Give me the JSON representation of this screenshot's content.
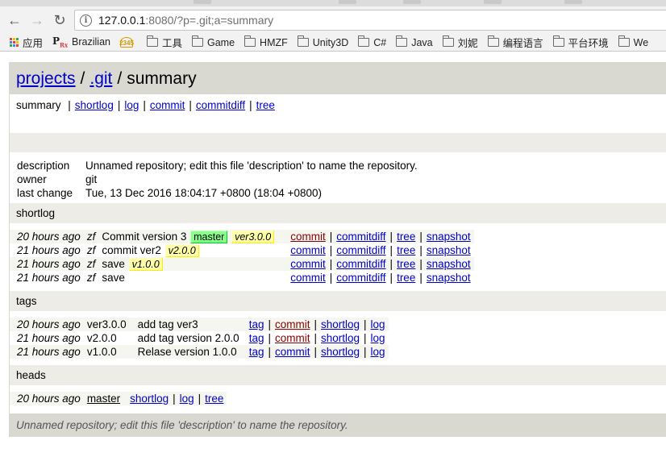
{
  "browser": {
    "url_host": "127.0.0.1",
    "url_rest": ":8080/?p=.git;a=summary",
    "bookmarks": [
      {
        "label": "应用",
        "icon": "apps-grid-icon"
      },
      {
        "label": "Brazilian",
        "icon": "rx-icon"
      },
      {
        "label": "",
        "icon": "2345-icon"
      },
      {
        "label": "工具",
        "icon": "folder-icon"
      },
      {
        "label": "Game",
        "icon": "folder-icon"
      },
      {
        "label": "HMZF",
        "icon": "folder-icon"
      },
      {
        "label": "Unity3D",
        "icon": "folder-icon"
      },
      {
        "label": "C#",
        "icon": "folder-icon"
      },
      {
        "label": "Java",
        "icon": "folder-icon"
      },
      {
        "label": "刘妮",
        "icon": "folder-icon"
      },
      {
        "label": "编程语言",
        "icon": "folder-icon"
      },
      {
        "label": "平台环境",
        "icon": "folder-icon"
      },
      {
        "label": "We",
        "icon": "folder-icon"
      }
    ]
  },
  "header": {
    "projects": "projects",
    "sep": "/",
    "repo": ".git",
    "action": "summary"
  },
  "nav": {
    "current": "summary",
    "links": [
      "shortlog",
      "log",
      "commit",
      "commitdiff",
      "tree"
    ],
    "sep": "|"
  },
  "info": [
    {
      "key": "description",
      "value": "Unnamed repository; edit this file 'description' to name the repository."
    },
    {
      "key": "owner",
      "value": "git"
    },
    {
      "key": "last change",
      "value": "Tue, 13 Dec 2016 18:04:17 +0800 (18:04 +0800)"
    }
  ],
  "shortlog": {
    "title": "shortlog",
    "rows": [
      {
        "age": "20 hours ago",
        "author": "zf",
        "subject": "Commit version 3",
        "heads": [
          "master"
        ],
        "tags": [
          "ver3.0.0"
        ],
        "links": [
          "commit",
          "commitdiff",
          "tree",
          "snapshot"
        ]
      },
      {
        "age": "21 hours ago",
        "author": "zf",
        "subject": "commit ver2",
        "heads": [],
        "tags": [
          "v2.0.0"
        ],
        "links": [
          "commit",
          "commitdiff",
          "tree",
          "snapshot"
        ]
      },
      {
        "age": "21 hours ago",
        "author": "zf",
        "subject": "save",
        "heads": [],
        "tags": [
          "v1.0.0"
        ],
        "links": [
          "commit",
          "commitdiff",
          "tree",
          "snapshot"
        ]
      },
      {
        "age": "21 hours ago",
        "author": "zf",
        "subject": "save",
        "heads": [],
        "tags": [],
        "links": [
          "commit",
          "commitdiff",
          "tree",
          "snapshot"
        ]
      }
    ]
  },
  "tags": {
    "title": "tags",
    "rows": [
      {
        "age": "20 hours ago",
        "name": "ver3.0.0",
        "message": "add tag ver3",
        "links": [
          "tag",
          "commit",
          "shortlog",
          "log"
        ]
      },
      {
        "age": "21 hours ago",
        "name": "v2.0.0",
        "message": "add tag version 2.0.0",
        "links": [
          "tag",
          "commit",
          "shortlog",
          "log"
        ]
      },
      {
        "age": "21 hours ago",
        "name": "v1.0.0",
        "message": "Relase version 1.0.0",
        "links": [
          "tag",
          "commit",
          "shortlog",
          "log"
        ]
      }
    ]
  },
  "heads": {
    "title": "heads",
    "rows": [
      {
        "age": "20 hours ago",
        "name": "master",
        "links": [
          "shortlog",
          "log",
          "tree"
        ]
      }
    ]
  },
  "footer": {
    "text": "Unnamed repository; edit this file 'description' to name the repository."
  }
}
